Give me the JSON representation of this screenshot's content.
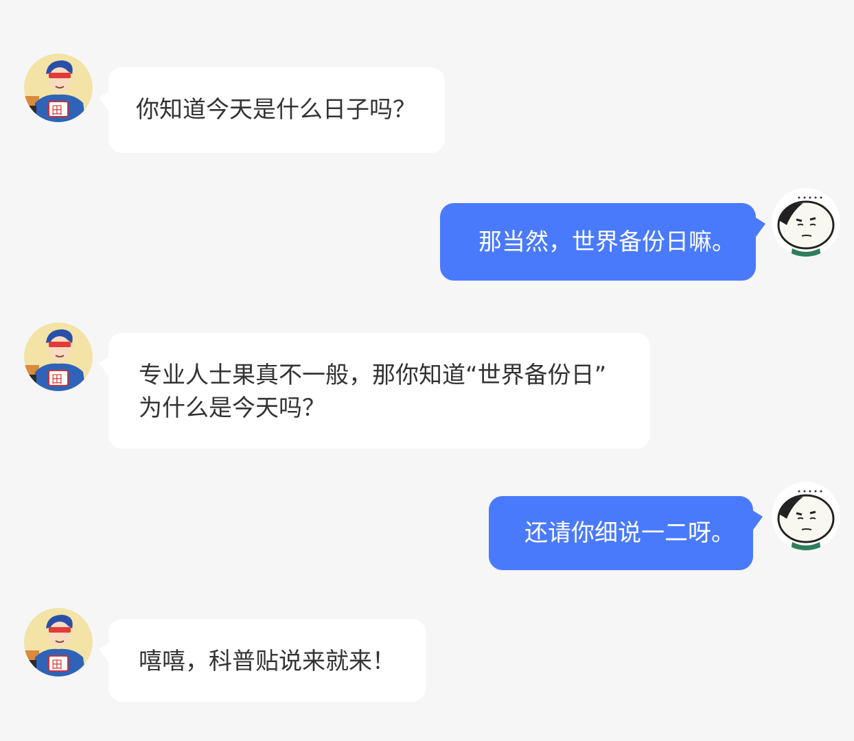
{
  "theme": {
    "background": "#f6f6f6",
    "incoming_bubble": "#ffffff",
    "outgoing_bubble": "#4a7afc",
    "incoming_text": "#333333",
    "outgoing_text": "#ffffff"
  },
  "avatars": {
    "incoming": "superhero-avatar",
    "outgoing": "meme-face-avatar"
  },
  "messages": [
    {
      "side": "incoming",
      "lines": [
        "你知道今天是什么日子吗？"
      ]
    },
    {
      "side": "outgoing",
      "lines": [
        "那当然，世界备份日嘛。"
      ]
    },
    {
      "side": "incoming",
      "lines": [
        "专业人士果真不一般，那你知道“世界备份日”",
        "为什么是今天吗？"
      ]
    },
    {
      "side": "outgoing",
      "lines": [
        "还请你细说一二呀。"
      ]
    },
    {
      "side": "incoming",
      "lines": [
        "嘻嘻，科普贴说来就来！"
      ]
    }
  ]
}
